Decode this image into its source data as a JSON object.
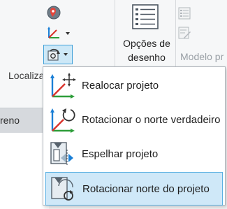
{
  "ribbon": {
    "panel_location_label": "Localiza",
    "drawing_options_label": "Opções de desenho",
    "drawing_options_line1": "Opções de",
    "drawing_options_line2": "desenho",
    "model_panel_label": "Modelo pr"
  },
  "browser": {
    "strip_label": "reno"
  },
  "dropdown": {
    "items": [
      {
        "label": "Realocar projeto",
        "icon": "relocate-project-icon"
      },
      {
        "label": "Rotacionar o norte verdadeiro",
        "icon": "rotate-true-north-icon"
      },
      {
        "label": "Espelhar projeto",
        "icon": "mirror-project-icon"
      },
      {
        "label": "Rotacionar norte do projeto",
        "icon": "rotate-project-north-icon",
        "selected": true
      }
    ]
  },
  "colors": {
    "selection_fill": "#cfe8f8",
    "selection_border": "#5ab0e2",
    "axis_blue": "#1a7fd6",
    "axis_green": "#2e9e3a",
    "axis_red": "#d9322b"
  }
}
